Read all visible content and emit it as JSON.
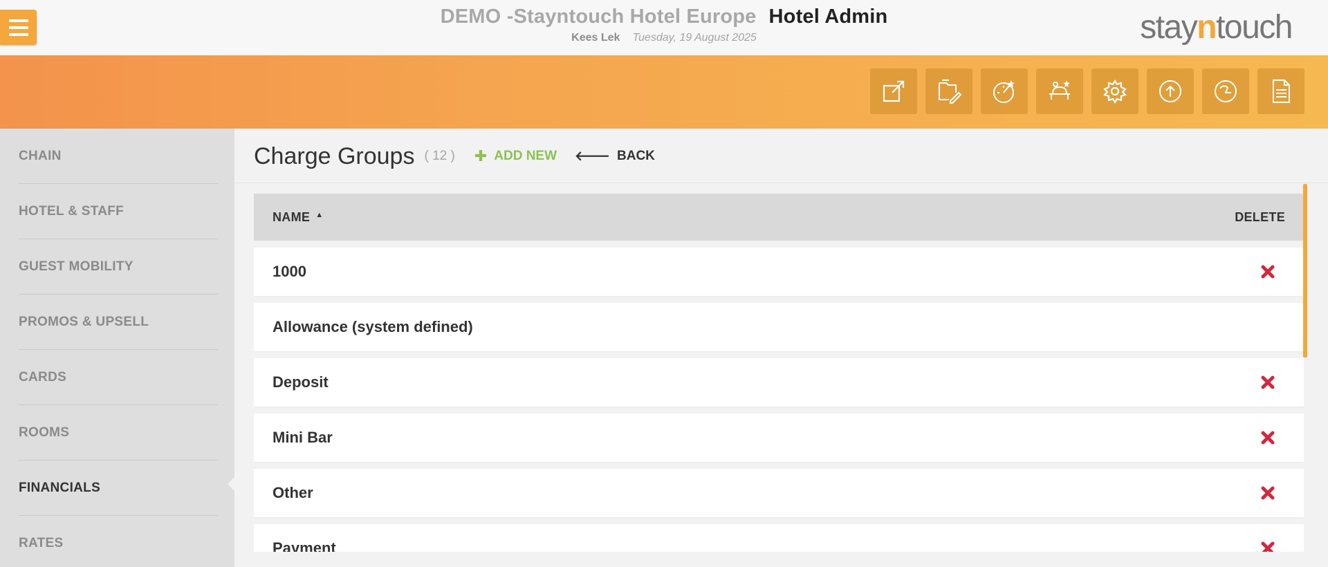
{
  "header": {
    "hotel_name": "DEMO -Stayntouch Hotel Europe",
    "app_name": "Hotel Admin",
    "user": "Kees Lek",
    "date": "Tuesday, 19 August 2025",
    "logo": {
      "prefix": "stay",
      "accent": "n",
      "suffix": "touch"
    }
  },
  "toolbar": {
    "icons": [
      "external-link-icon",
      "edit-folder-icon",
      "dashboard-gauge-icon",
      "room-service-icon",
      "gear-icon",
      "upload-icon",
      "clock-history-icon",
      "document-icon"
    ]
  },
  "sidebar": {
    "items": [
      {
        "label": "CHAIN"
      },
      {
        "label": "HOTEL & STAFF"
      },
      {
        "label": "GUEST MOBILITY"
      },
      {
        "label": "PROMOS & UPSELL"
      },
      {
        "label": "CARDS"
      },
      {
        "label": "ROOMS"
      },
      {
        "label": "FINANCIALS",
        "active": true
      },
      {
        "label": "RATES"
      }
    ]
  },
  "main": {
    "title": "Charge Groups",
    "count": "( 12 )",
    "add_new": "ADD NEW",
    "back": "BACK",
    "table": {
      "col_name": "NAME",
      "col_delete": "DELETE",
      "rows": [
        {
          "name": "1000",
          "deletable": true
        },
        {
          "name": "Allowance (system defined)",
          "deletable": false
        },
        {
          "name": "Deposit",
          "deletable": true
        },
        {
          "name": "Mini Bar",
          "deletable": true
        },
        {
          "name": "Other",
          "deletable": true
        },
        {
          "name": "Payment",
          "deletable": true
        }
      ]
    }
  },
  "colors": {
    "accent": "#f5a73b",
    "add_green": "#8cc152",
    "delete_red": "#d0283d"
  }
}
